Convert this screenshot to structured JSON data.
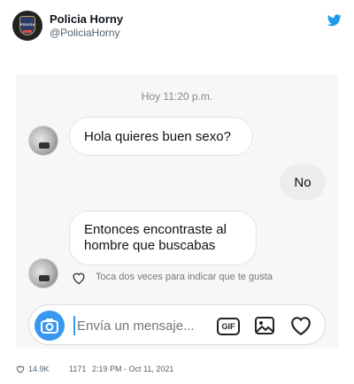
{
  "tweet": {
    "display_name": "Policia Horny",
    "handle": "@PoliciaHorny",
    "avatar_badge_text": "POLICIA",
    "likes": "14.9K",
    "replies": "1171",
    "timestamp": "2:19 PM - Oct 11, 2021"
  },
  "chat": {
    "time": "Hoy 11:20 p.m.",
    "messages": [
      {
        "from": "them",
        "text": "Hola quieres buen sexo?"
      },
      {
        "from": "me",
        "text": "No"
      },
      {
        "from": "them",
        "text": "Entonces encontraste al hombre que buscabas"
      }
    ],
    "like_hint": "Toca dos veces para indicar que te gusta",
    "composer": {
      "placeholder": "Envía un mensaje...",
      "gif_label": "GIF"
    }
  },
  "colors": {
    "twitter_blue": "#1d9bf0",
    "camera_blue": "#3897f0",
    "chat_background": "#f7f7f7"
  },
  "icons": [
    "twitter-bird-icon",
    "heart-icon",
    "camera-icon",
    "gif-icon",
    "image-icon"
  ]
}
